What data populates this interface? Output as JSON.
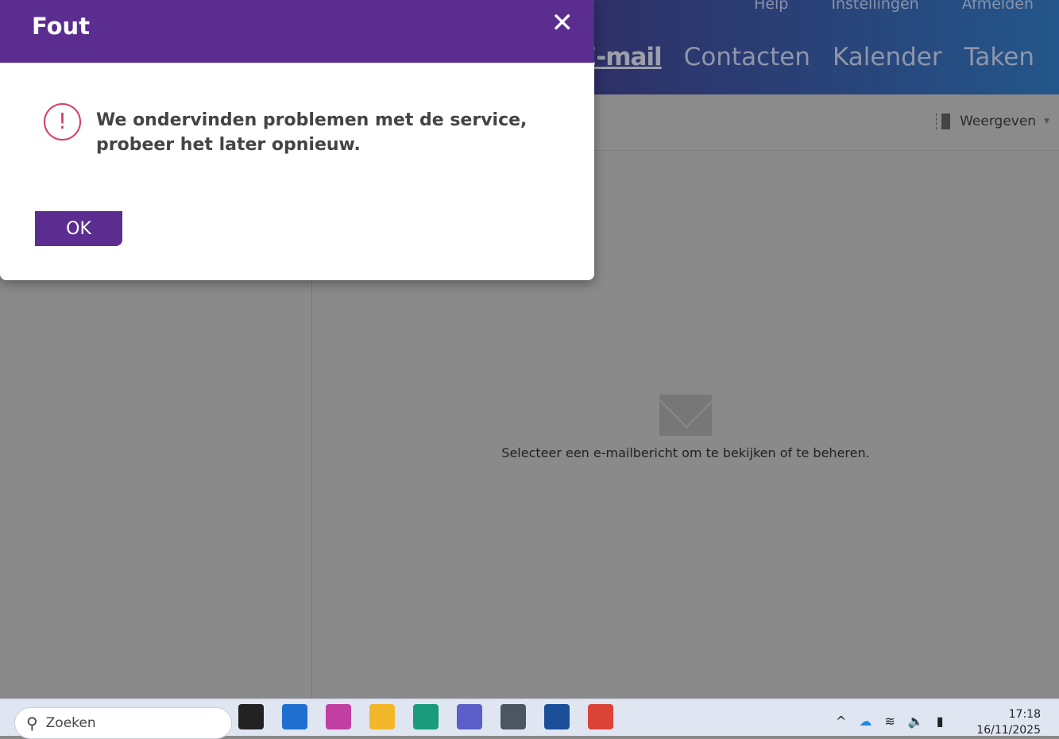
{
  "header": {
    "links": [
      "Help",
      "Instellingen",
      "Afmelden"
    ],
    "nav": [
      "E-mail",
      "Contacten",
      "Kalender",
      "Taken"
    ]
  },
  "toolbar": {
    "view_label": "Weergeven"
  },
  "reading_pane": {
    "empty_text": "Selecteer een e-mailbericht om te bekijken of te beheren."
  },
  "dialog": {
    "title": "Fout",
    "message_line1": "We ondervinden problemen met de service,",
    "message_line2": "probeer het later opnieuw.",
    "ok_label": "OK",
    "error_symbol": "!"
  },
  "taskbar": {
    "search_placeholder": "Zoeken",
    "time": "17:18",
    "date": "16/11/2025",
    "apps": [
      {
        "name": "task-view",
        "color": "#222"
      },
      {
        "name": "outlook",
        "color": "#1f6fd1"
      },
      {
        "name": "r-app",
        "color": "#c03fa0"
      },
      {
        "name": "file-explorer",
        "color": "#f2b829"
      },
      {
        "name": "edge",
        "color": "#1a9b7a"
      },
      {
        "name": "teams",
        "color": "#5b5fc7"
      },
      {
        "name": "calculator",
        "color": "#4b5563"
      },
      {
        "name": "store",
        "color": "#1c4f9a"
      },
      {
        "name": "chrome",
        "color": "#db4437"
      }
    ]
  }
}
